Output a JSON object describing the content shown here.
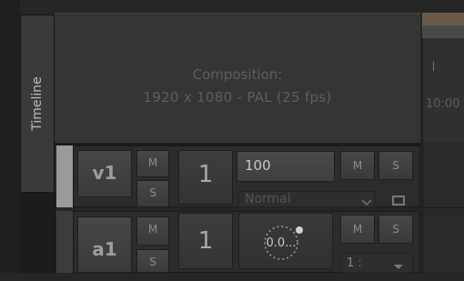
{
  "sidebar": {
    "timeline_tab_label": "Timeline"
  },
  "composition": {
    "title": "Composition:",
    "info": "1920 x 1080 - PAL (25 fps)"
  },
  "ruler": {
    "time_label": "10:00"
  },
  "tracks": [
    {
      "name": "v1",
      "mute_label": "M",
      "solo_label": "S",
      "layer_number": "1",
      "opacity_value": "100",
      "opacity_mute_label": "M",
      "opacity_solo_label": "S",
      "blend_mode": "Normal"
    },
    {
      "name": "a1",
      "mute_label": "M",
      "solo_label": "S",
      "layer_number": "1",
      "volume_value": "0.0...",
      "volume_mute_label": "M",
      "volume_solo_label": "S",
      "channel_value": "1"
    }
  ],
  "colors": {
    "background": "#262626",
    "panel": "#353535",
    "ruler_accent": "#6a5a48",
    "selected_track_bar": "#9a9a9a"
  },
  "icons": {
    "blend_dropdown": "chevron-down-icon",
    "blend_extra": "link-icon",
    "channel_dropdown": "chevron-down-icon",
    "volume_knob": "knob-icon"
  }
}
